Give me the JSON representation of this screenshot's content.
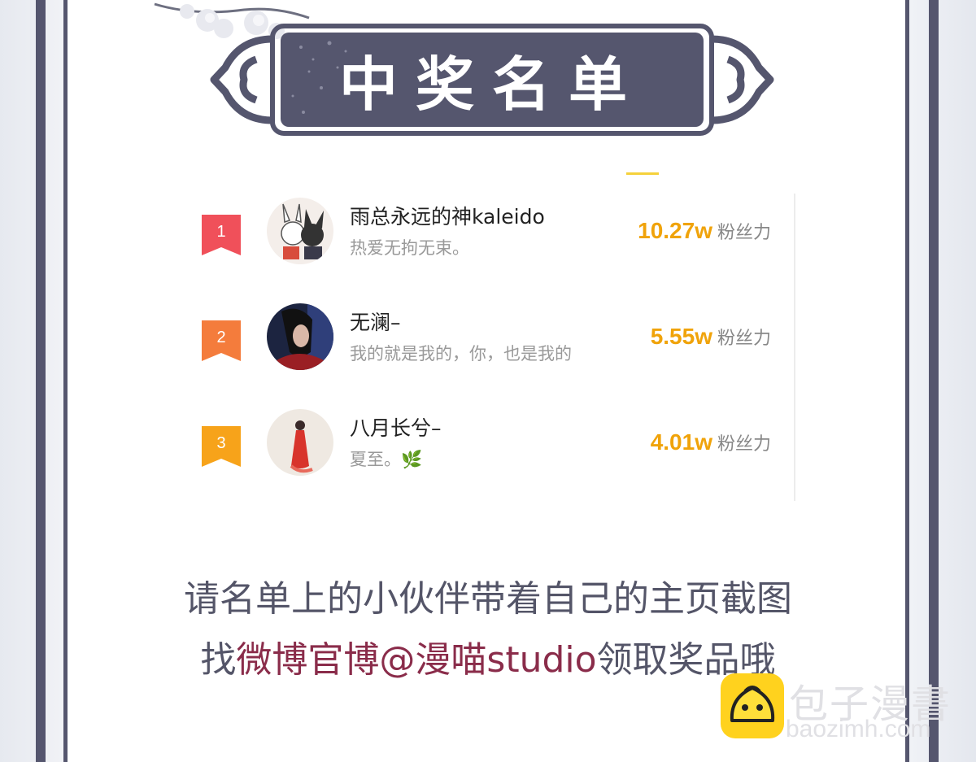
{
  "header": {
    "title": "中奖名单"
  },
  "ranking": [
    {
      "rank": "1",
      "name": "雨总永远的神kaleido",
      "bio": "热爱无拘无束。",
      "fans": "10.27w",
      "fans_unit": "粉丝力",
      "badge_color": "#f0505a"
    },
    {
      "rank": "2",
      "name": "无澜–",
      "bio": "我的就是我的，你，也是我的",
      "fans": "5.55w",
      "fans_unit": "粉丝力",
      "badge_color": "#f47c3c"
    },
    {
      "rank": "3",
      "name": "八月长兮–",
      "bio": "夏至。🌿",
      "fans": "4.01w",
      "fans_unit": "粉丝力",
      "badge_color": "#f7a31a"
    }
  ],
  "notice": {
    "line1": "请名单上的小伙伴带着自己的主页截图",
    "line2_prefix": "找",
    "line2_highlight": "微博官博@漫喵studio",
    "line2_suffix": "领取奖品哦"
  },
  "watermark": {
    "name": "包子漫書",
    "url": "baozimh.com"
  },
  "colors": {
    "frame": "#55566e",
    "accent": "#f0a30a",
    "highlight": "#8a2c4a"
  }
}
